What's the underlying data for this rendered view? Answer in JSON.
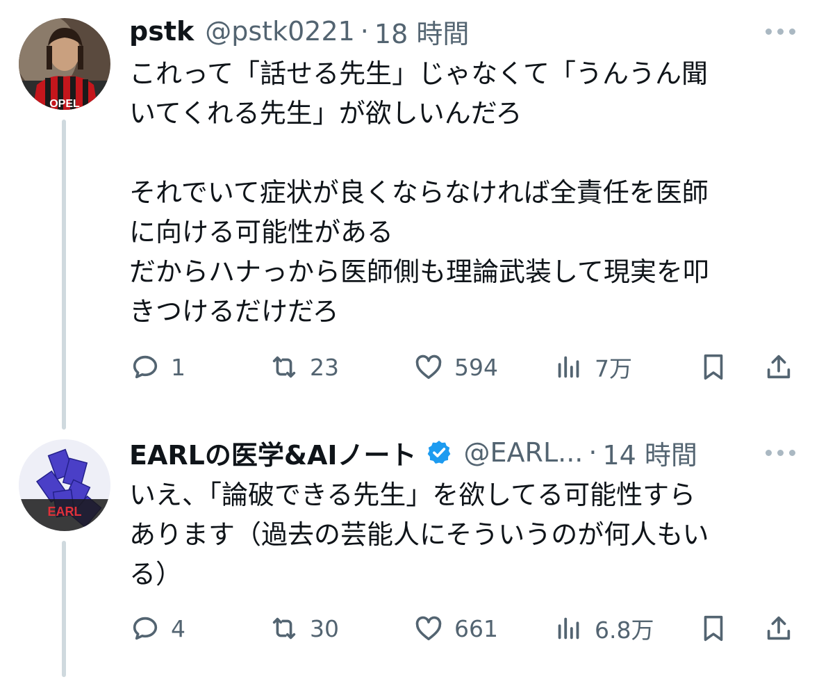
{
  "tweets": [
    {
      "name": "pstk",
      "handle": "@pstk0221",
      "dot": "·",
      "time": "18 時間",
      "text": "これって「話せる先生」じゃなくて「うんうん聞\nいてくれる先生」が欲しいんだろ\n\nそれでいて症状が良くならなければ全責任を医師\nに向ける可能性がある\nだからハナっから医師側も理論武装して現実を叩\nきつけるだけだろ",
      "avatar_text": "OPEL",
      "verified": false,
      "actions": {
        "replies": "1",
        "retweets": "23",
        "likes": "594",
        "views": "7万"
      }
    },
    {
      "name": "EARLの医学&AIノート",
      "handle": "@EARL...",
      "dot": "·",
      "time": "14 時間",
      "text": "いえ、「論破できる先生」を欲してる可能性すら\nあります（過去の芸能人にそういうのが何人もい\nる）",
      "avatar_text": "EARL",
      "verified": true,
      "actions": {
        "replies": "4",
        "retweets": "30",
        "likes": "661",
        "views": "6.8万"
      }
    }
  ],
  "icons": {
    "reply": "reply-icon",
    "retweet": "retweet-icon",
    "like": "heart-icon",
    "views": "views-chart-icon",
    "bookmark": "bookmark-icon",
    "share": "share-icon",
    "more": "more-dots-icon",
    "verified": "verified-badge-icon"
  },
  "colors": {
    "text": "#0f1419",
    "secondary": "#536471",
    "thread_line": "#cfd9de",
    "verified": "#1d9bf0"
  }
}
